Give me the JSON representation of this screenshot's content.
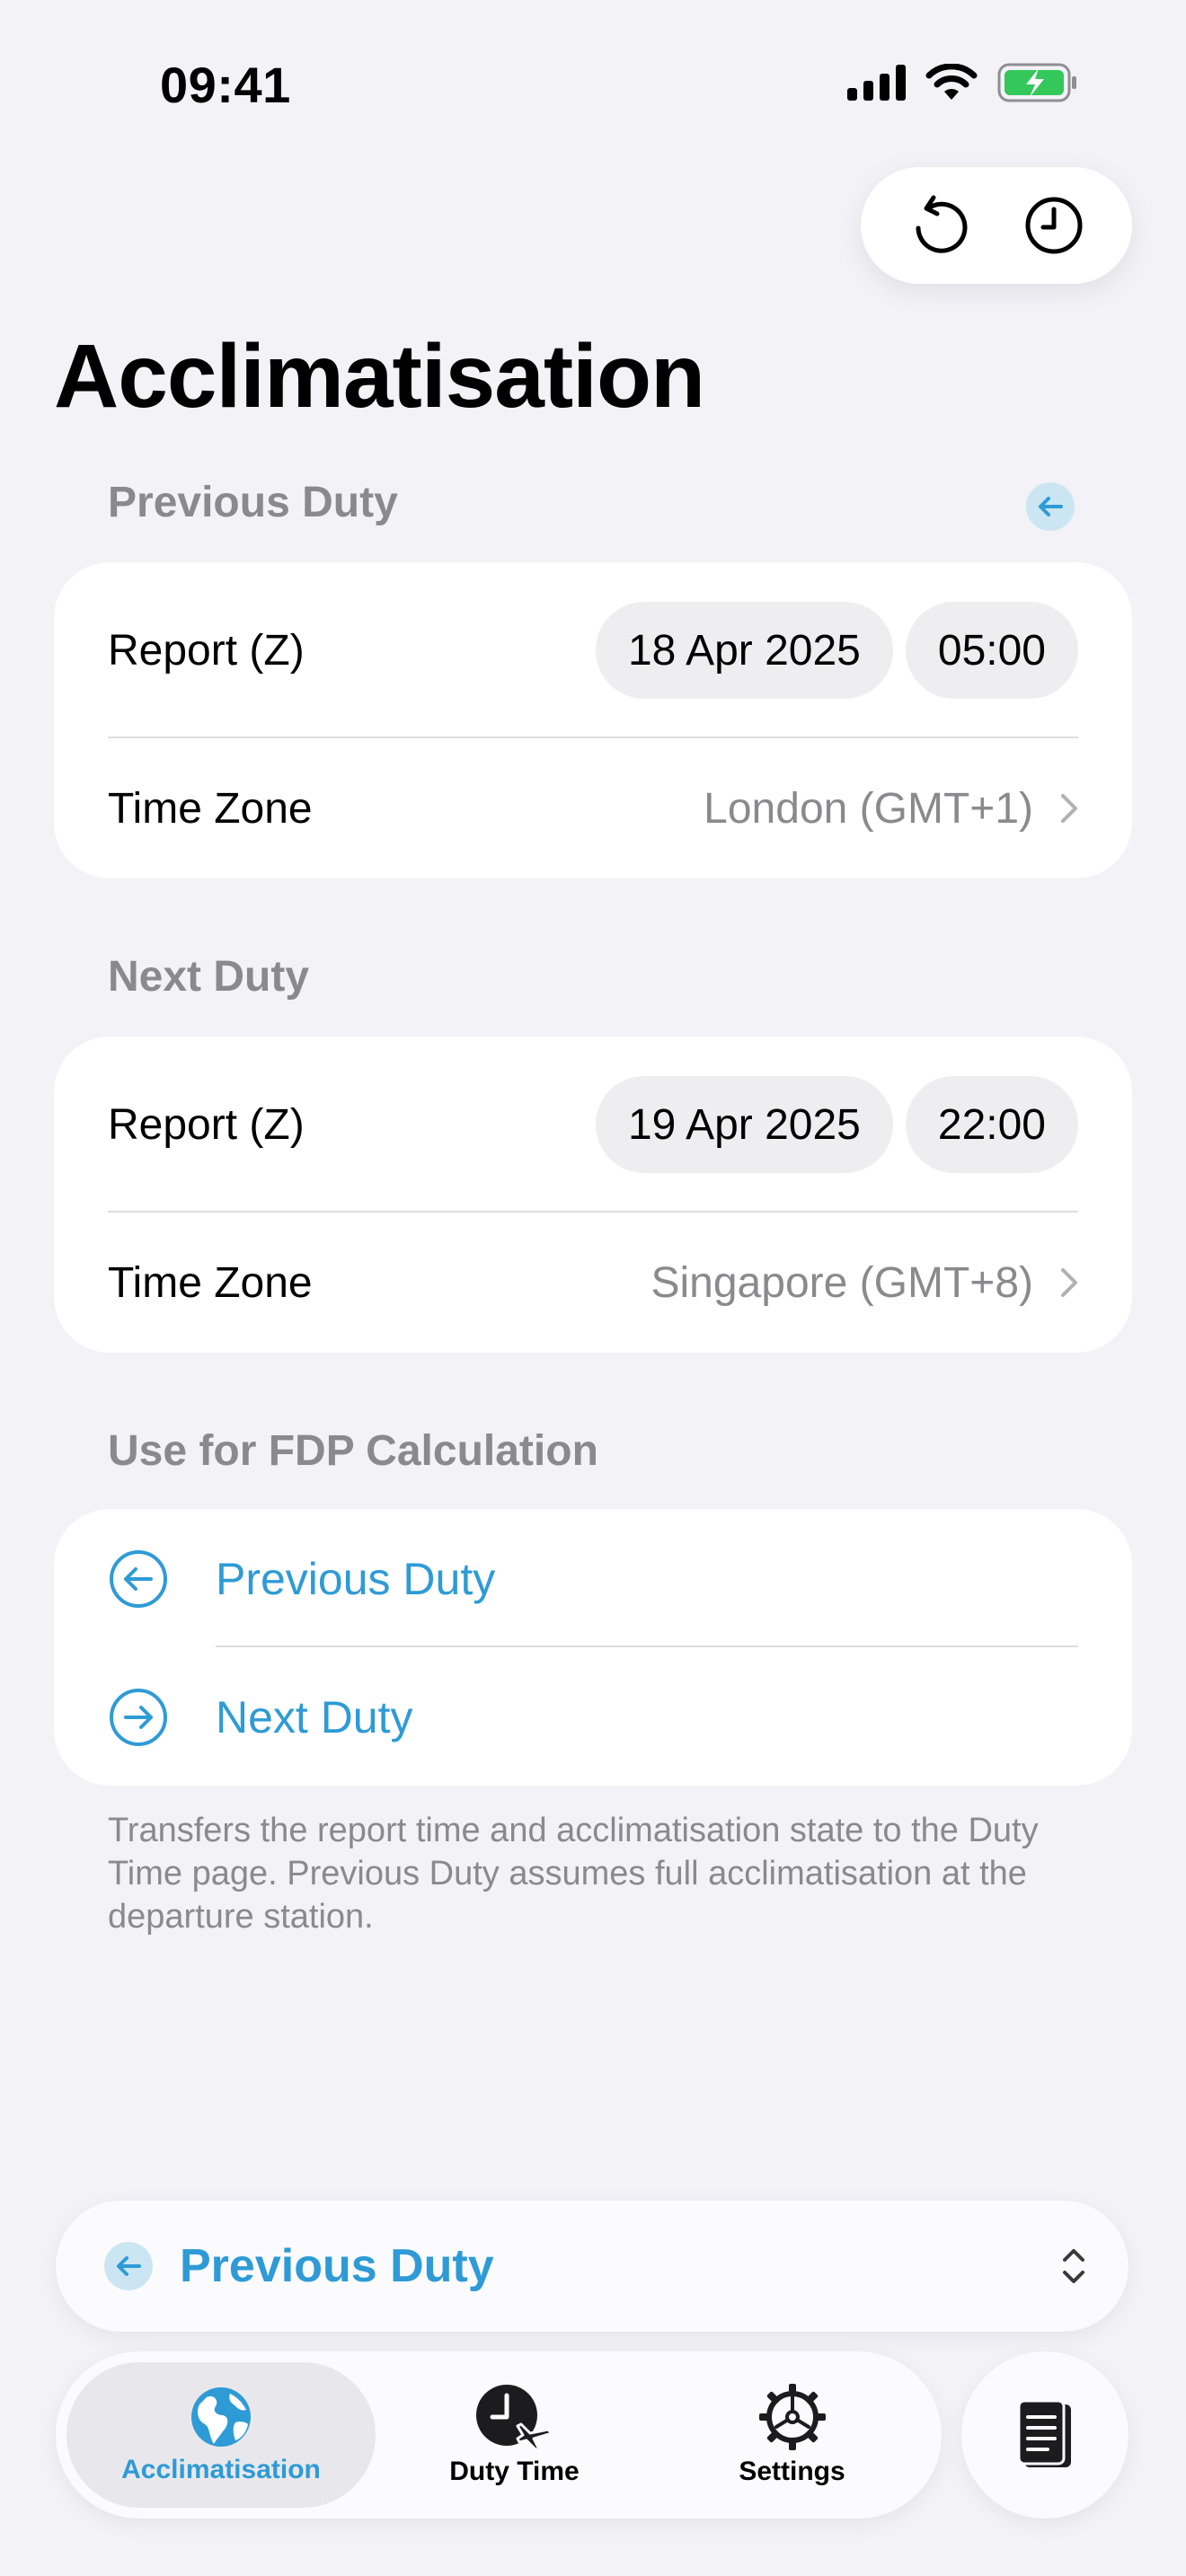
{
  "status_bar": {
    "time": "09:41"
  },
  "page": {
    "title": "Acclimatisation"
  },
  "previous_duty": {
    "header": "Previous Duty",
    "report_label": "Report (Z)",
    "report_date": "18 Apr 2025",
    "report_time": "05:00",
    "timezone_label": "Time Zone",
    "timezone_value": "London (GMT+1)"
  },
  "next_duty": {
    "header": "Next Duty",
    "report_label": "Report (Z)",
    "report_date": "19 Apr 2025",
    "report_time": "22:00",
    "timezone_label": "Time Zone",
    "timezone_value": "Singapore (GMT+8)"
  },
  "fdp": {
    "header": "Use for FDP Calculation",
    "options": [
      "Previous Duty",
      "Next Duty"
    ],
    "footnote": "Transfers the report time and acclimatisation state to the Duty Time page. Previous Duty assumes full acclimatisation at the departure station."
  },
  "picker": {
    "selected": "Previous Duty"
  },
  "tabbar": {
    "tabs": [
      "Acclimatisation",
      "Duty Time",
      "Settings"
    ],
    "active": "Acclimatisation"
  },
  "colors": {
    "accent": "#2E9BD6",
    "background": "#F2F2F7",
    "secondary_text": "#8A8A8E"
  },
  "icons": {
    "top_actions": [
      "reset-icon",
      "history-clock-icon"
    ],
    "tabs": [
      "globe-icon",
      "clock-plane-icon",
      "gear-icon"
    ],
    "side": "document-icon"
  }
}
